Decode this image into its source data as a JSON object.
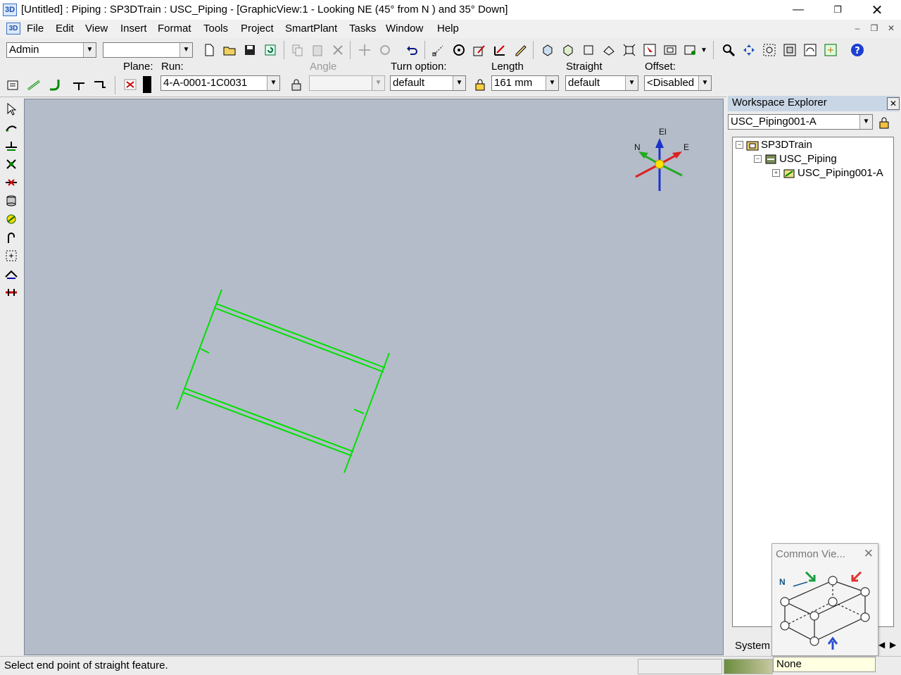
{
  "window": {
    "app_icon": "3D",
    "title": "[Untitled] : Piping : SP3DTrain : USC_Piping - [GraphicView:1 - Looking NE (45° from N ) and 35° Down]",
    "minimize_icon": "minimize-icon",
    "restore_icon": "restore-icon",
    "close_icon": "close-icon"
  },
  "menu": {
    "icon": "3D",
    "items": [
      "File",
      "Edit",
      "View",
      "Insert",
      "Format",
      "Tools",
      "Project",
      "SmartPlant",
      "Tasks",
      "Window",
      "Help"
    ]
  },
  "toolbar1": {
    "user_combo": "Admin",
    "second_combo": ""
  },
  "route_ribbon": {
    "plane_label": "Plane:",
    "run_label": "Run:",
    "run_value": "4-A-0001-1C0031",
    "angle_label": "Angle",
    "angle_value": "",
    "turn_option_label": "Turn option:",
    "turn_option_value": "default",
    "length_label": "Length",
    "length_value": "161 mm",
    "straight_label": "Straight",
    "straight_value": "default",
    "offset_label": "Offset:",
    "offset_value": "<Disabled"
  },
  "compass": {
    "north": "N",
    "east": "E",
    "elevation": "El"
  },
  "workspace_explorer": {
    "title": "Workspace Explorer",
    "filter_value": "USC_Piping001-A",
    "tree": [
      {
        "label": "SP3DTrain",
        "level": 0
      },
      {
        "label": "USC_Piping",
        "level": 1
      },
      {
        "label": "USC_Piping001-A",
        "level": 2
      }
    ],
    "tab_label": "System"
  },
  "common_views": {
    "title": "Common Vie...",
    "north_label": "N",
    "selection": "None"
  },
  "status": {
    "prompt": "Select end point of straight feature."
  },
  "colors": {
    "view_background": "#b4bcc9",
    "pipe_color": "#00e000",
    "axis_north": "#22aa22",
    "axis_east": "#dd2222",
    "axis_up": "#1a33cc"
  }
}
